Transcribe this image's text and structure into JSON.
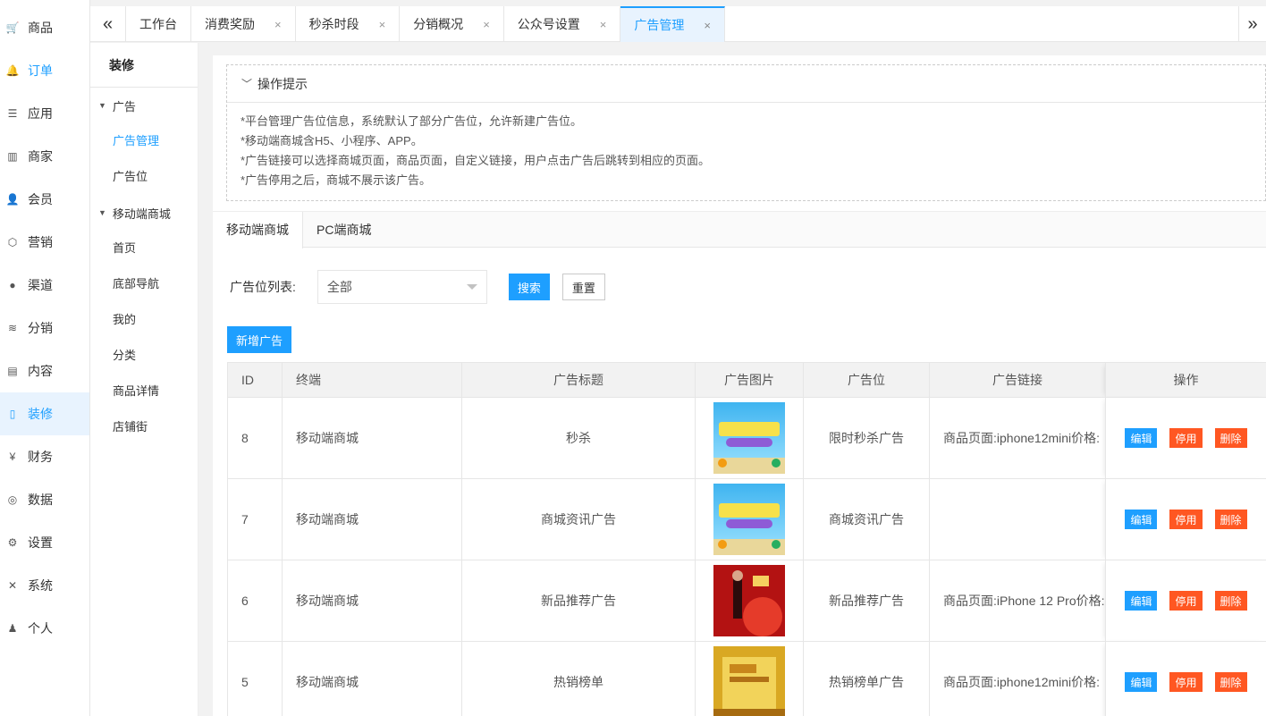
{
  "mainnav": [
    {
      "name": "cart-icon",
      "glyph": "🛒",
      "label": "商品",
      "active": false,
      "blue": false
    },
    {
      "name": "bell-icon",
      "glyph": "🔔",
      "label": "订单",
      "active": false,
      "blue": true
    },
    {
      "name": "list-icon",
      "glyph": "☰",
      "label": "应用",
      "active": false,
      "blue": false
    },
    {
      "name": "shop-icon",
      "glyph": "▥",
      "label": "商家",
      "active": false,
      "blue": false
    },
    {
      "name": "user-icon",
      "glyph": "👤",
      "label": "会员",
      "active": false,
      "blue": false
    },
    {
      "name": "cube-icon",
      "glyph": "⬡",
      "label": "营销",
      "active": false,
      "blue": false
    },
    {
      "name": "channel-icon",
      "glyph": "●",
      "label": "渠道",
      "active": false,
      "blue": false
    },
    {
      "name": "layers-icon",
      "glyph": "≋",
      "label": "分销",
      "active": false,
      "blue": false
    },
    {
      "name": "book-icon",
      "glyph": "▤",
      "label": "内容",
      "active": false,
      "blue": false
    },
    {
      "name": "tablet-icon",
      "glyph": "▯",
      "label": "装修",
      "active": true,
      "blue": false
    },
    {
      "name": "yen-icon",
      "glyph": "¥",
      "label": "财务",
      "active": false,
      "blue": false
    },
    {
      "name": "globe-icon",
      "glyph": "◎",
      "label": "数据",
      "active": false,
      "blue": false
    },
    {
      "name": "gear-icon",
      "glyph": "⚙",
      "label": "设置",
      "active": false,
      "blue": false
    },
    {
      "name": "tools-icon",
      "glyph": "✕",
      "label": "系统",
      "active": false,
      "blue": false
    },
    {
      "name": "person-icon",
      "glyph": "♟",
      "label": "个人",
      "active": false,
      "blue": false
    }
  ],
  "tabs": {
    "prev_glyph": "«",
    "next_glyph": "»",
    "items": [
      {
        "label": "工作台",
        "closable": false,
        "active": false
      },
      {
        "label": "消费奖励",
        "closable": true,
        "active": false
      },
      {
        "label": "秒杀时段",
        "closable": true,
        "active": false
      },
      {
        "label": "分销概况",
        "closable": true,
        "active": false
      },
      {
        "label": "公众号设置",
        "closable": true,
        "active": false
      },
      {
        "label": "广告管理",
        "closable": true,
        "active": true
      }
    ],
    "close_glyph": "×"
  },
  "subnav": {
    "title": "装修",
    "groups": [
      {
        "label": "广告",
        "items": [
          {
            "label": "广告管理",
            "active": true
          },
          {
            "label": "广告位",
            "active": false
          }
        ]
      },
      {
        "label": "移动端商城",
        "items": [
          {
            "label": "首页",
            "active": false
          },
          {
            "label": "底部导航",
            "active": false
          },
          {
            "label": "我的",
            "active": false
          },
          {
            "label": "分类",
            "active": false
          },
          {
            "label": "商品详情",
            "active": false
          },
          {
            "label": "店铺街",
            "active": false
          }
        ]
      }
    ]
  },
  "tips": {
    "title": "操作提示",
    "lines": [
      "*平台管理广告位信息，系统默认了部分广告位，允许新建广告位。",
      "*移动端商城含H5、小程序、APP。",
      "*广告链接可以选择商城页面，商品页面，自定义链接，用户点击广告后跳转到相应的页面。",
      "*广告停用之后，商城不展示该广告。"
    ]
  },
  "subtabs": [
    {
      "label": "移动端商城",
      "active": true
    },
    {
      "label": "PC端商城",
      "active": false
    }
  ],
  "filter": {
    "label": "广告位列表:",
    "selected": "全部",
    "search_label": "搜索",
    "reset_label": "重置"
  },
  "add_label": "新增广告",
  "table": {
    "headers": [
      "ID",
      "终端",
      "广告标题",
      "广告图片",
      "广告位",
      "广告链接",
      "操作"
    ],
    "rows": [
      {
        "id": "8",
        "terminal": "移动端商城",
        "title": "秒杀",
        "thumb": "blue",
        "position": "限时秒杀广告",
        "link": "商品页面:iphone12mini价格:"
      },
      {
        "id": "7",
        "terminal": "移动端商城",
        "title": "商城资讯广告",
        "thumb": "blue",
        "position": "商城资讯广告",
        "link": ""
      },
      {
        "id": "6",
        "terminal": "移动端商城",
        "title": "新品推荐广告",
        "thumb": "red",
        "position": "新品推荐广告",
        "link": "商品页面:iPhone 12 Pro价格:"
      },
      {
        "id": "5",
        "terminal": "移动端商城",
        "title": "热销榜单",
        "thumb": "gold",
        "position": "热销榜单广告",
        "link": "商品页面:iphone12mini价格:"
      }
    ],
    "actions": {
      "edit": "编辑",
      "stop": "停用",
      "delete": "删除"
    }
  },
  "colors": {
    "accent": "#1e9fff",
    "danger": "#ff5722",
    "active_bg": "#e8f3fe"
  }
}
